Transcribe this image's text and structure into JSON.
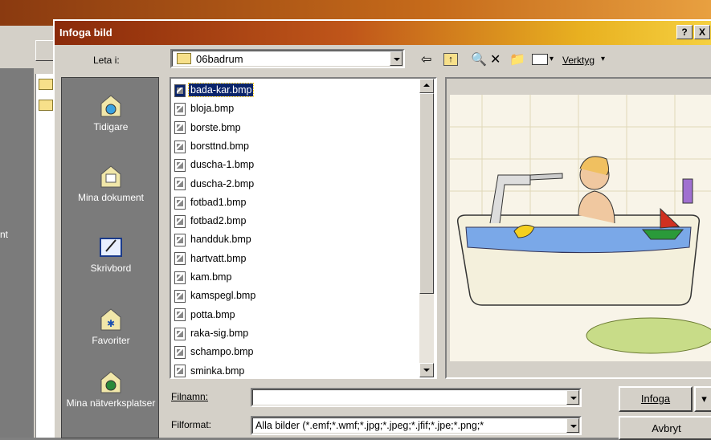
{
  "background": {
    "left_text": "nt"
  },
  "dialog": {
    "title": "Infoga bild",
    "help_btn": "?",
    "close_btn": "X",
    "look_in_label": "Leta i:",
    "look_in_value": "06badrum",
    "tools_label": "Verktyg"
  },
  "places": [
    {
      "label": "Tidigare"
    },
    {
      "label": "Mina dokument"
    },
    {
      "label": "Skrivbord"
    },
    {
      "label": "Favoriter"
    },
    {
      "label": "Mina nätverksplatser"
    }
  ],
  "files": [
    "bada-kar.bmp",
    "bloja.bmp",
    "borste.bmp",
    "borsttnd.bmp",
    "duscha-1.bmp",
    "duscha-2.bmp",
    "fotbad1.bmp",
    "fotbad2.bmp",
    "handduk.bmp",
    "hartvatt.bmp",
    "kam.bmp",
    "kamspegl.bmp",
    "potta.bmp",
    "raka-sig.bmp",
    "schampo.bmp",
    "sminka.bmp"
  ],
  "selected_file": "bada-kar.bmp",
  "filename": {
    "label": "Filnamn:",
    "value": ""
  },
  "fileformat": {
    "label": "Filformat:",
    "value": "Alla bilder (*.emf;*.wmf;*.jpg;*.jpeg;*.jfif;*.jpe;*.png;*"
  },
  "buttons": {
    "insert": "Infoga",
    "cancel": "Avbryt"
  }
}
